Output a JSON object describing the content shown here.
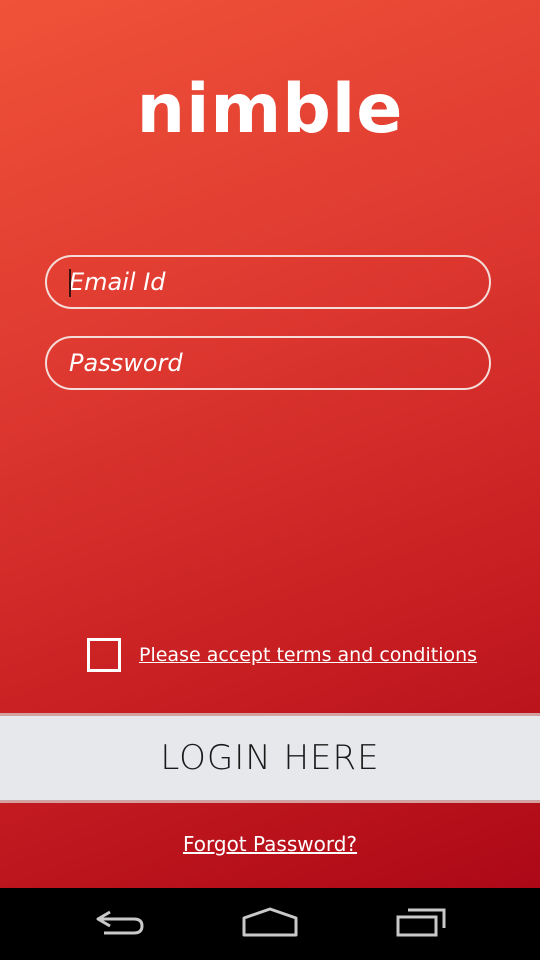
{
  "app": {
    "logo_text": "nimble"
  },
  "login_form": {
    "email_placeholder": "Email Id",
    "password_placeholder": "Password",
    "terms_label": "Please accept terms and conditions",
    "terms_checked": false,
    "login_button_label": "LOGIN HERE",
    "forgot_password_label": "Forgot Password?"
  },
  "navigation_bar": {
    "buttons": [
      "back-icon",
      "home-icon",
      "recents-icon"
    ]
  },
  "colors": {
    "gradient_top": "#ef5238",
    "gradient_bottom": "#ad0817",
    "login_bar_bg": "#e6e8ec",
    "nav_bar_bg": "#000000"
  }
}
